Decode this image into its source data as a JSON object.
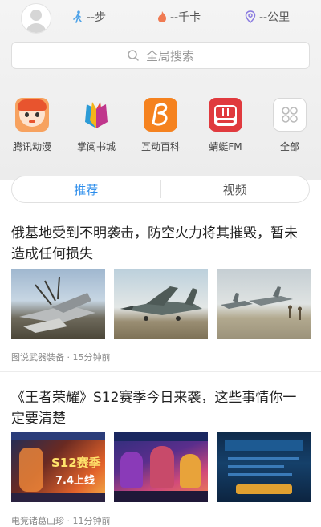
{
  "header": {
    "steps": "--步",
    "calories": "--千卡",
    "distance": "--公里"
  },
  "search": {
    "placeholder": "全局搜索"
  },
  "apps": [
    {
      "label": "腾讯动漫",
      "icon": "tencent-comic-icon",
      "color": "#f06a3b"
    },
    {
      "label": "掌阅书城",
      "icon": "ireader-icon",
      "color": "#e8433c"
    },
    {
      "label": "互动百科",
      "icon": "hudong-baike-icon",
      "color": "#f5821f"
    },
    {
      "label": "蜻蜓FM",
      "icon": "qingting-fm-icon",
      "color": "#e03a3e"
    },
    {
      "label": "全部",
      "icon": "all-apps-icon",
      "color": "#cccccc"
    }
  ],
  "tabs": [
    {
      "label": "推荐",
      "active": true
    },
    {
      "label": "视频",
      "active": false
    }
  ],
  "news": [
    {
      "title": "俄基地受到不明袭击，防空火力将其摧毁，暂未造成任何损失",
      "meta": "图说武器装备 · 15分钟前"
    },
    {
      "title": "《王者荣耀》S12赛季今日来袭，这些事情你一定要清楚",
      "meta": "电竞诸葛山珍 · 11分钟前",
      "thumb_texts": [
        "S12赛季",
        "7.4上线"
      ]
    }
  ],
  "colors": {
    "accent": "#2a8ceb"
  }
}
